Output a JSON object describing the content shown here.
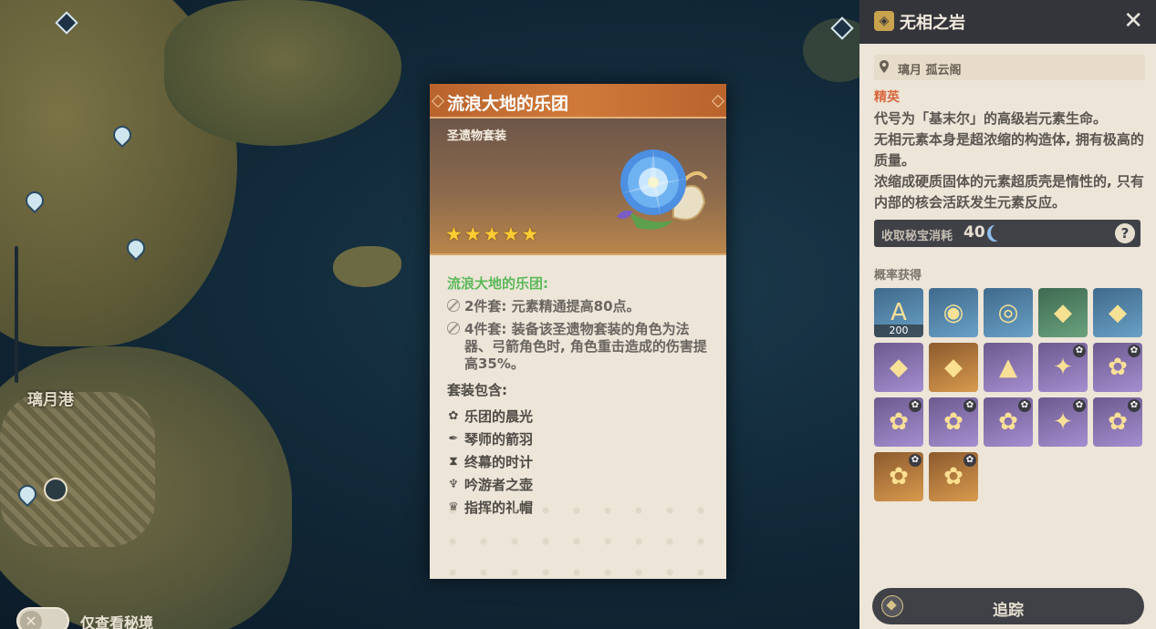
{
  "map": {
    "location_label": "璃月港",
    "toggle_label": "仅查看秘境",
    "toggle_icon": "✕"
  },
  "card": {
    "title": "流浪大地的乐团",
    "type_label": "圣遗物套装",
    "rarity_stars": 5,
    "star_glyph": "★",
    "set_name": "流浪大地的乐团:",
    "effect_2pc": "2件套: 元素精通提高80点。",
    "effect_4pc": "4件套: 装备该圣遗物套装的角色为法器、弓箭角色时, 角色重击造成的伤害提高35%。",
    "contains_label": "套装包含:",
    "pieces": [
      {
        "icon": "flower-icon",
        "glyph": "✿",
        "name": "乐团的晨光"
      },
      {
        "icon": "feather-icon",
        "glyph": "✒",
        "name": "琴师的箭羽"
      },
      {
        "icon": "hourglass-icon",
        "glyph": "⧗",
        "name": "终幕的时计"
      },
      {
        "icon": "goblet-icon",
        "glyph": "♆",
        "name": "吟游者之壶"
      },
      {
        "icon": "crown-icon",
        "glyph": "♛",
        "name": "指挥的礼帽"
      }
    ]
  },
  "panel": {
    "title": "无相之岩",
    "close_glyph": "✕",
    "location": "璃月 孤云阁",
    "rank": "精英",
    "description": [
      "代号为「基末尔」的高级岩元素生命。",
      "无相元素本身是超浓缩的构造体, 拥有极高的质量。",
      "浓缩成硬质固体的元素超质壳是惰性的, 只有内部的核会活跃发生元素反应。"
    ],
    "cost_label": "收取秘宝消耗",
    "cost_value": "40",
    "help_glyph": "?",
    "drops_title": "概率获得",
    "drops": [
      {
        "rarity": "r3",
        "glyph": "A",
        "count": "200",
        "tag": ""
      },
      {
        "rarity": "r3",
        "glyph": "◉",
        "count": "",
        "tag": ""
      },
      {
        "rarity": "r3",
        "glyph": "◎",
        "count": "",
        "tag": ""
      },
      {
        "rarity": "r2",
        "glyph": "◆",
        "count": "",
        "tag": ""
      },
      {
        "rarity": "r3",
        "glyph": "◆",
        "count": "",
        "tag": ""
      },
      {
        "rarity": "r4",
        "glyph": "◆",
        "count": "",
        "tag": ""
      },
      {
        "rarity": "r5",
        "glyph": "◆",
        "count": "",
        "tag": ""
      },
      {
        "rarity": "r4",
        "glyph": "▲",
        "count": "",
        "tag": ""
      },
      {
        "rarity": "r4",
        "glyph": "✦",
        "count": "",
        "tag": "✿"
      },
      {
        "rarity": "r4",
        "glyph": "✿",
        "count": "",
        "tag": "✿"
      },
      {
        "rarity": "r4",
        "glyph": "✿",
        "count": "",
        "tag": "✿"
      },
      {
        "rarity": "r4",
        "glyph": "✿",
        "count": "",
        "tag": "✿"
      },
      {
        "rarity": "r4",
        "glyph": "✿",
        "count": "",
        "tag": "✿"
      },
      {
        "rarity": "r4",
        "glyph": "✦",
        "count": "",
        "tag": "✿"
      },
      {
        "rarity": "r4",
        "glyph": "✿",
        "count": "",
        "tag": "✿"
      },
      {
        "rarity": "r5",
        "glyph": "✿",
        "count": "",
        "tag": "✿"
      },
      {
        "rarity": "r5",
        "glyph": "✿",
        "count": "",
        "tag": "✿"
      }
    ],
    "track_label": "追踪"
  }
}
